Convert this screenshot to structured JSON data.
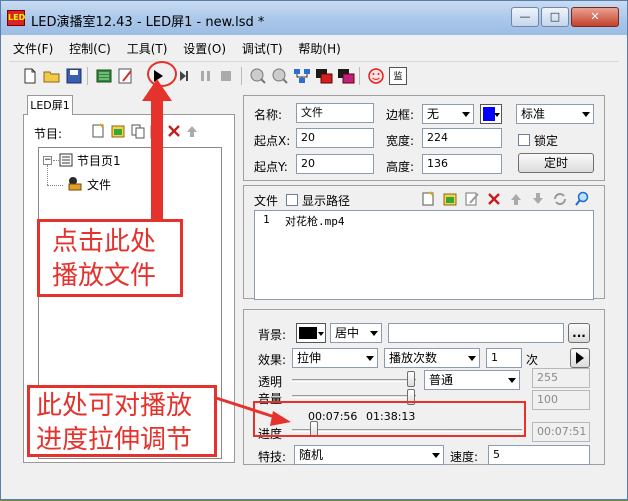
{
  "window": {
    "title": "LED演播室12.43 - LED屏1 - new.lsd *",
    "app_icon_text": "LED",
    "minimize": "—",
    "maximize": "□",
    "close": "✕"
  },
  "menu": [
    "文件(F)",
    "控制(C)",
    "工具(T)",
    "设置(O)",
    "调试(T)",
    "帮助(H)"
  ],
  "toolbar": {
    "monitor_label": "监"
  },
  "left": {
    "tab": "LED屏1",
    "program_label": "节目:",
    "tree": {
      "page": "节目页1",
      "file": "文件"
    }
  },
  "props": {
    "name_label": "名称:",
    "name_value": "文件",
    "x_label": "起点X:",
    "x_value": "20",
    "y_label": "起点Y:",
    "y_value": "20",
    "border_label": "边框:",
    "border_value": "无",
    "border_style": "标准",
    "width_label": "宽度:",
    "width_value": "224",
    "height_label": "高度:",
    "height_value": "136",
    "lock_label": "锁定",
    "timer_button": "定时"
  },
  "files": {
    "label": "文件",
    "show_path": "显示路径",
    "rows": [
      {
        "index": "1",
        "name": "对花枪.mp4"
      }
    ]
  },
  "media": {
    "bg_label": "背景:",
    "bg_align": "居中",
    "browse": "...",
    "effect_label": "效果:",
    "effect_value": "拉伸",
    "play_mode": "播放次数",
    "times_value": "1",
    "times_unit": "次",
    "transparency_label": "透明",
    "transparency_mode": "普通",
    "transparency_value": "255",
    "volume_label": "音量",
    "volume_value": "100",
    "progress_label": "进度",
    "time_current": "00:07:56",
    "time_total": "01:38:13",
    "time_box": "00:07:51",
    "fx_label": "特技:",
    "fx_value": "随机",
    "speed_label": "速度:",
    "speed_value": "5",
    "progress_fraction": 0.08
  },
  "annotations": {
    "play_callout_line1": "点击此处",
    "play_callout_line2": "播放文件",
    "progress_callout_line1": "此处可对播放",
    "progress_callout_line2": "进度拉伸调节"
  },
  "colors": {
    "accent_red": "#e5322d",
    "border_color_swatch": "#0000ff",
    "bg_color_swatch": "#000000"
  }
}
